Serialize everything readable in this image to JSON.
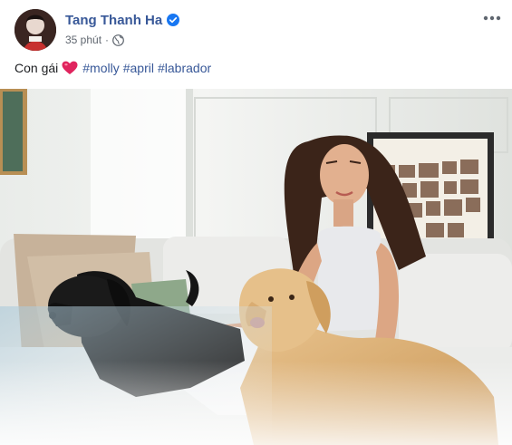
{
  "post": {
    "author": {
      "name": "Tang Thanh Ha",
      "verified": true,
      "avatar_icon": "profile-avatar"
    },
    "timestamp": "35 phút",
    "separator": "·",
    "audience_icon": "globe-icon",
    "menu_icon": "more-options-icon",
    "caption": {
      "text": "Con gái",
      "emoji": "heart-emoji",
      "hashtags": [
        "#molly",
        "#april",
        "#labrador"
      ]
    },
    "photo": {
      "description_icon": "post-photo"
    }
  },
  "colors": {
    "author_link": "#385898",
    "hashtag": "#385898",
    "meta_text": "#606770",
    "verified_badge": "#1877f2",
    "heart": "#e0245e"
  }
}
